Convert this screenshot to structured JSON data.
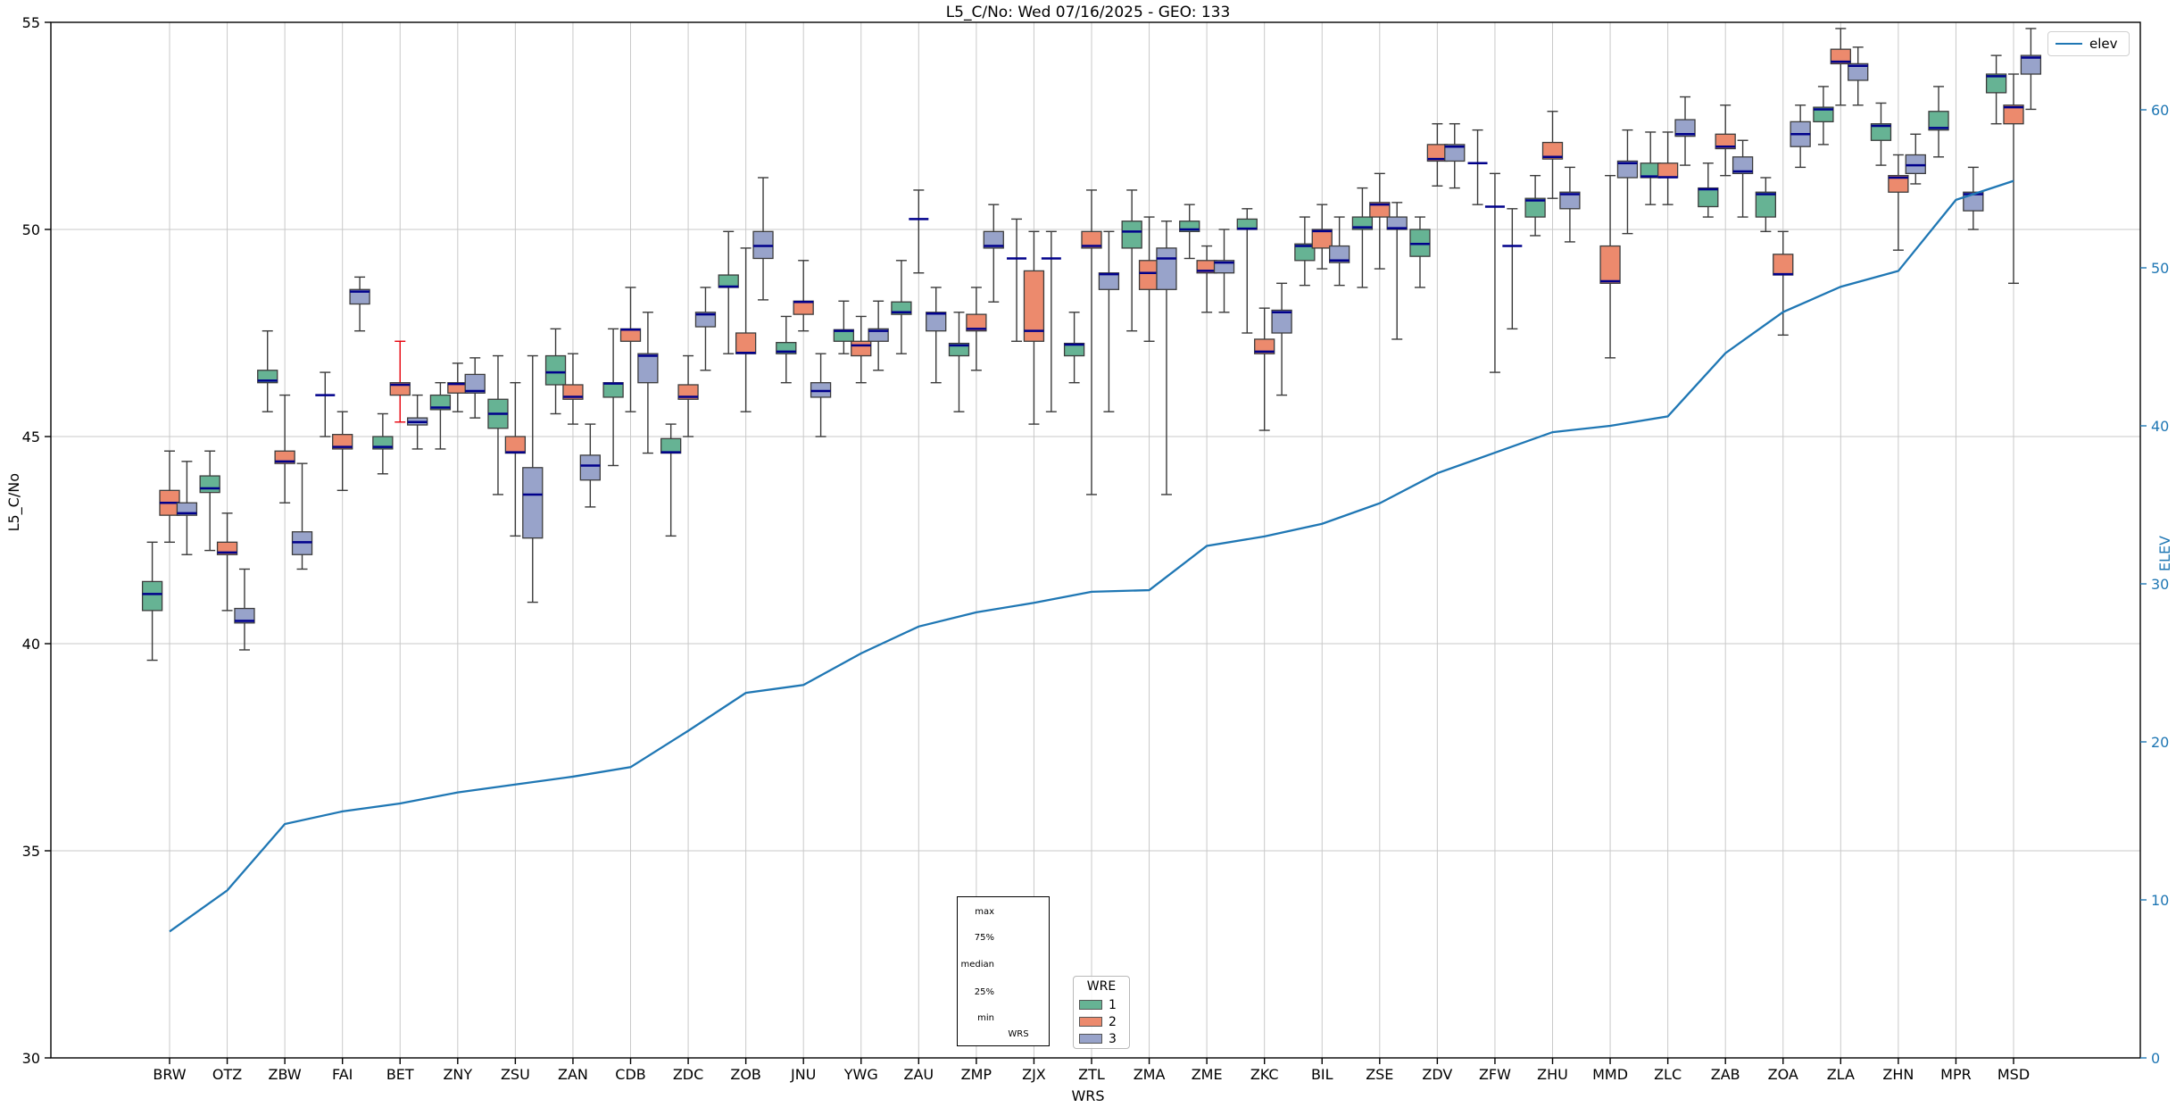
{
  "title": "L5_C/No: Wed 07/16/2025 - GEO: 133",
  "axes": {
    "ylabel": "L5_C/No",
    "xlabel": "WRS",
    "right_ylabel": "ELEV",
    "y_ticks": [
      30,
      35,
      40,
      45,
      50,
      55
    ],
    "ylim": [
      30,
      55
    ],
    "right_ticks": [
      0,
      10,
      20,
      30,
      40,
      50,
      60
    ],
    "grid": true
  },
  "legend_elev": {
    "label": "elev"
  },
  "legend_wre": {
    "title": "WRE",
    "entries": [
      {
        "label": "1",
        "color": "#66b394"
      },
      {
        "label": "2",
        "color": "#ec8a6d"
      },
      {
        "label": "3",
        "color": "#98a3ca"
      }
    ]
  },
  "inset": {
    "labels": [
      "max",
      "75%",
      "median",
      "25%",
      "min"
    ],
    "xlabel": "WRS"
  },
  "colors": {
    "wre1": "#66b394",
    "wre2": "#ec8a6d",
    "wre3": "#98a3ca",
    "box_edge": "#3c3c3c",
    "median": "#00008b",
    "whisker": "#3a3a3a",
    "red_whisker": "#e8000b",
    "elev_line": "#1f77b4",
    "grid": "#c9c9c9",
    "inset_box": "#7b74e0",
    "inset_median": "#ff7f0e",
    "right_axis_text": "#1f77b4"
  },
  "chart_data": {
    "type": "boxplot+line",
    "title": "L5_C/No: Wed 07/16/2025 - GEO: 133",
    "xlabel": "WRS",
    "ylabel": "L5_C/No",
    "ylabel_right": "ELEV",
    "ylim": [
      30,
      55
    ],
    "ylim_right": [
      0,
      65.5
    ],
    "categories": [
      "BRW",
      "OTZ",
      "ZBW",
      "FAI",
      "BET",
      "ZNY",
      "ZSU",
      "ZAN",
      "CDB",
      "ZDC",
      "ZOB",
      "JNU",
      "YWG",
      "ZAU",
      "ZMP",
      "ZJX",
      "ZTL",
      "ZMA",
      "ZME",
      "ZKC",
      "BIL",
      "ZSE",
      "ZDV",
      "ZFW",
      "ZHU",
      "MMD",
      "ZLC",
      "ZAB",
      "ZOA",
      "ZLA",
      "ZHN",
      "MPR",
      "MSD"
    ],
    "box_format": [
      "whisker_low",
      "q1",
      "median",
      "q3",
      "whisker_high",
      "optional_whisker_color"
    ],
    "series": [
      {
        "name": "1",
        "boxes": [
          [
            39.6,
            40.8,
            41.2,
            41.5,
            42.45
          ],
          [
            42.25,
            43.65,
            43.75,
            44.05,
            44.65
          ],
          [
            45.6,
            46.3,
            46.35,
            46.6,
            47.55
          ],
          [
            45.0,
            46.0,
            46.0,
            46.0,
            46.55
          ],
          [
            44.1,
            44.7,
            44.75,
            45.0,
            45.55
          ],
          [
            44.7,
            45.65,
            45.7,
            46.0,
            46.3
          ],
          [
            43.6,
            45.2,
            45.55,
            45.9,
            46.95
          ],
          [
            45.55,
            46.25,
            46.55,
            46.95,
            47.6
          ],
          [
            44.3,
            45.95,
            46.28,
            46.3,
            47.6
          ],
          [
            42.6,
            44.6,
            44.62,
            44.95,
            45.3
          ],
          [
            47.0,
            48.6,
            48.62,
            48.9,
            49.95
          ],
          [
            46.3,
            47.0,
            47.05,
            47.27,
            47.9
          ],
          [
            47.0,
            47.3,
            47.55,
            47.58,
            48.27
          ],
          [
            47.0,
            47.95,
            48.0,
            48.25,
            49.25
          ],
          [
            45.6,
            46.95,
            47.2,
            47.25,
            48.0
          ],
          [
            47.3,
            49.3,
            49.3,
            49.3,
            50.25
          ],
          [
            46.3,
            46.95,
            47.22,
            47.25,
            48.0
          ],
          [
            47.55,
            49.55,
            49.95,
            50.2,
            50.95
          ],
          [
            49.3,
            49.95,
            50.0,
            50.2,
            50.6
          ],
          [
            47.5,
            50.0,
            50.02,
            50.25,
            50.5
          ],
          [
            48.65,
            49.25,
            49.6,
            49.65,
            50.3
          ],
          [
            48.6,
            50.0,
            50.05,
            50.3,
            51.0
          ],
          [
            48.6,
            49.35,
            49.65,
            50.0,
            50.3
          ],
          [
            50.6,
            51.6,
            51.6,
            51.6,
            52.4
          ],
          [
            49.85,
            50.3,
            50.7,
            50.75,
            51.3
          ],
          null,
          [
            50.6,
            51.25,
            51.28,
            51.6,
            52.35
          ],
          [
            50.3,
            50.55,
            50.97,
            51.0,
            51.6
          ],
          [
            49.95,
            50.3,
            50.85,
            50.9,
            51.25
          ],
          [
            52.05,
            52.6,
            52.9,
            52.95,
            53.45
          ],
          [
            51.55,
            52.15,
            52.5,
            52.55,
            53.05
          ],
          [
            51.75,
            52.4,
            52.45,
            52.85,
            53.45
          ],
          [
            52.55,
            53.3,
            53.7,
            53.75,
            54.2
          ]
        ]
      },
      {
        "name": "2",
        "boxes": [
          [
            42.45,
            43.1,
            43.4,
            43.7,
            44.65
          ],
          [
            40.8,
            42.15,
            42.2,
            42.45,
            43.15
          ],
          [
            43.4,
            44.35,
            44.4,
            44.65,
            46.0
          ],
          [
            43.7,
            44.7,
            44.75,
            45.05,
            45.6
          ],
          [
            45.35,
            46.0,
            46.25,
            46.3,
            47.3,
            "red"
          ],
          [
            45.6,
            46.05,
            46.27,
            46.3,
            46.77
          ],
          [
            42.6,
            44.6,
            44.62,
            45.0,
            46.3
          ],
          [
            45.3,
            45.9,
            45.96,
            46.25,
            47.0
          ],
          [
            45.6,
            47.3,
            47.58,
            47.6,
            48.6
          ],
          [
            45.0,
            45.9,
            45.96,
            46.25,
            46.95
          ],
          [
            45.6,
            47.0,
            47.02,
            47.5,
            49.55
          ],
          [
            47.55,
            47.95,
            48.25,
            48.27,
            49.25
          ],
          [
            46.3,
            46.95,
            47.2,
            47.3,
            47.9
          ],
          [
            48.95,
            50.25,
            50.25,
            50.25,
            50.95
          ],
          [
            46.6,
            47.55,
            47.6,
            47.95,
            48.6
          ],
          [
            45.3,
            47.3,
            47.55,
            49.0,
            49.95
          ],
          [
            43.6,
            49.55,
            49.6,
            49.95,
            50.95
          ],
          [
            47.3,
            48.55,
            48.95,
            49.25,
            50.3
          ],
          [
            48.0,
            48.95,
            49.0,
            49.25,
            49.6
          ],
          [
            45.15,
            47.0,
            47.05,
            47.35,
            48.1
          ],
          [
            49.05,
            49.55,
            49.96,
            50.0,
            50.6
          ],
          [
            49.05,
            50.3,
            50.6,
            50.65,
            51.35
          ],
          [
            51.05,
            51.65,
            51.7,
            52.05,
            52.55
          ],
          [
            46.55,
            50.55,
            50.55,
            50.55,
            51.35
          ],
          [
            50.75,
            51.7,
            51.75,
            52.1,
            52.85
          ],
          [
            46.9,
            48.7,
            48.75,
            49.6,
            51.3
          ],
          [
            50.6,
            51.25,
            51.26,
            51.6,
            52.35
          ],
          [
            51.3,
            51.95,
            52.0,
            52.3,
            53.0
          ],
          [
            47.45,
            48.9,
            48.92,
            49.4,
            49.95
          ],
          [
            53.0,
            54.0,
            54.05,
            54.35,
            54.85
          ],
          [
            49.5,
            50.9,
            51.25,
            51.3,
            51.8
          ],
          null,
          [
            48.7,
            52.55,
            52.95,
            53.0,
            53.75
          ]
        ]
      },
      {
        "name": "3",
        "boxes": [
          [
            42.15,
            43.1,
            43.15,
            43.4,
            44.4
          ],
          [
            39.85,
            40.5,
            40.55,
            40.85,
            41.8
          ],
          [
            41.8,
            42.15,
            42.45,
            42.7,
            44.35
          ],
          [
            47.55,
            48.2,
            48.5,
            48.55,
            48.85
          ],
          [
            44.7,
            45.28,
            45.35,
            45.45,
            46.0
          ],
          [
            45.45,
            46.05,
            46.1,
            46.5,
            46.9
          ],
          [
            41.0,
            42.55,
            43.6,
            44.25,
            46.95
          ],
          [
            43.3,
            43.95,
            44.3,
            44.55,
            45.3
          ],
          [
            44.6,
            46.3,
            46.95,
            47.0,
            48.0
          ],
          [
            46.6,
            47.65,
            47.95,
            48.0,
            48.6
          ],
          [
            48.3,
            49.3,
            49.6,
            49.95,
            51.25
          ],
          [
            45.0,
            45.95,
            46.1,
            46.3,
            47.0
          ],
          [
            46.6,
            47.3,
            47.55,
            47.6,
            48.27
          ],
          [
            46.3,
            47.55,
            47.97,
            48.0,
            48.6
          ],
          [
            48.25,
            49.55,
            49.6,
            49.95,
            50.6
          ],
          [
            45.6,
            49.3,
            49.3,
            49.3,
            49.95
          ],
          [
            45.6,
            48.55,
            48.92,
            48.95,
            49.95
          ],
          [
            43.6,
            48.55,
            49.3,
            49.55,
            50.2
          ],
          [
            48.0,
            48.95,
            49.2,
            49.25,
            50.0
          ],
          [
            46.0,
            47.5,
            48.0,
            48.05,
            48.7
          ],
          [
            48.65,
            49.2,
            49.25,
            49.6,
            50.3
          ],
          [
            47.35,
            50.0,
            50.03,
            50.3,
            50.65
          ],
          [
            51.0,
            51.65,
            52.0,
            52.05,
            52.55
          ],
          [
            47.6,
            49.6,
            49.6,
            49.6,
            50.5
          ],
          [
            49.7,
            50.5,
            50.85,
            50.9,
            51.5
          ],
          [
            49.9,
            51.25,
            51.6,
            51.65,
            52.4
          ],
          [
            51.55,
            52.25,
            52.3,
            52.65,
            53.2
          ],
          [
            50.3,
            51.35,
            51.4,
            51.75,
            52.15
          ],
          [
            51.5,
            52.0,
            52.3,
            52.6,
            53.0
          ],
          [
            53.0,
            53.6,
            53.95,
            54.0,
            54.4
          ],
          [
            51.1,
            51.35,
            51.55,
            51.8,
            52.3
          ],
          [
            50.0,
            50.45,
            50.85,
            50.9,
            51.5
          ],
          [
            52.9,
            53.75,
            54.15,
            54.2,
            54.85
          ]
        ]
      }
    ],
    "elev_series": {
      "name": "elev",
      "values": [
        8.0,
        10.6,
        14.8,
        15.6,
        16.1,
        16.8,
        17.3,
        17.8,
        18.4,
        20.7,
        23.1,
        23.6,
        25.6,
        27.3,
        28.2,
        28.8,
        29.5,
        29.6,
        32.4,
        33.0,
        33.8,
        35.1,
        37.0,
        38.3,
        39.6,
        40.0,
        40.6,
        44.6,
        47.2,
        48.8,
        49.8,
        54.3,
        55.5
      ]
    }
  }
}
